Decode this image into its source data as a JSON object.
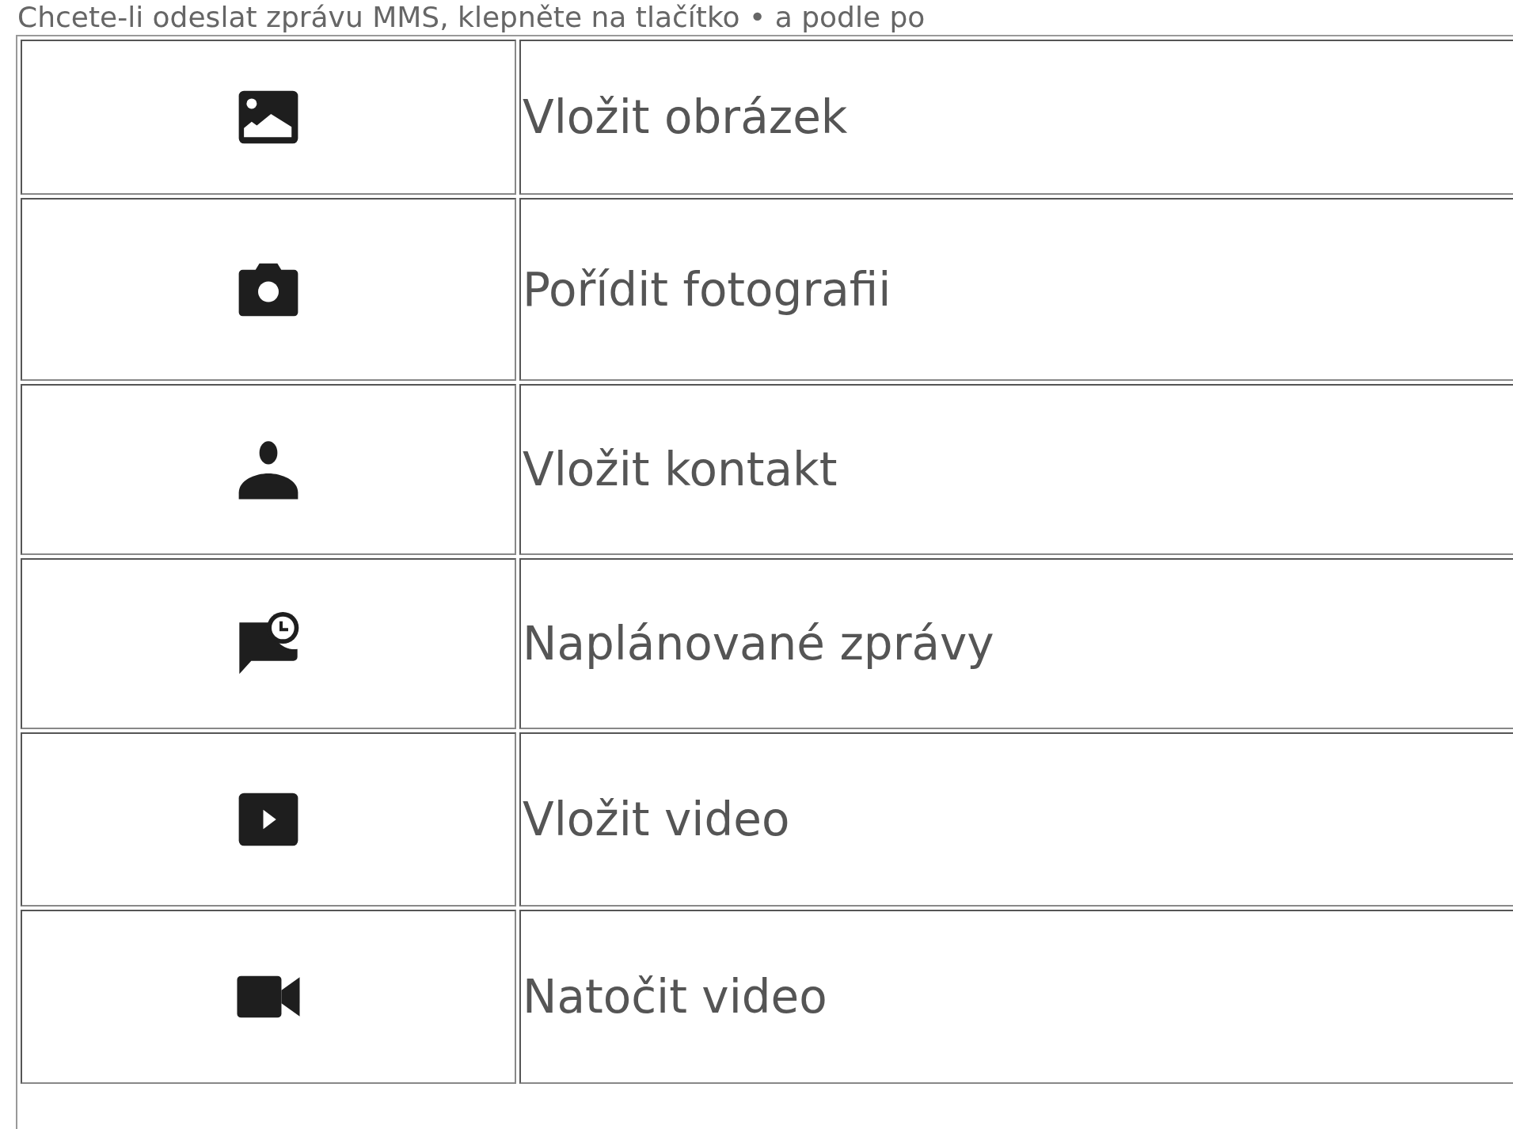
{
  "intro_text": "Chcete-li odeslat zprávu MMS, klepněte na tlačítko • a podle po",
  "rows": [
    {
      "label": "Vložit obrázek"
    },
    {
      "label": "Pořídit fotografii"
    },
    {
      "label": "Vložit kontakt"
    },
    {
      "label": "Naplánované zprávy"
    },
    {
      "label": "Vložit video"
    },
    {
      "label": "Natočit video"
    }
  ]
}
